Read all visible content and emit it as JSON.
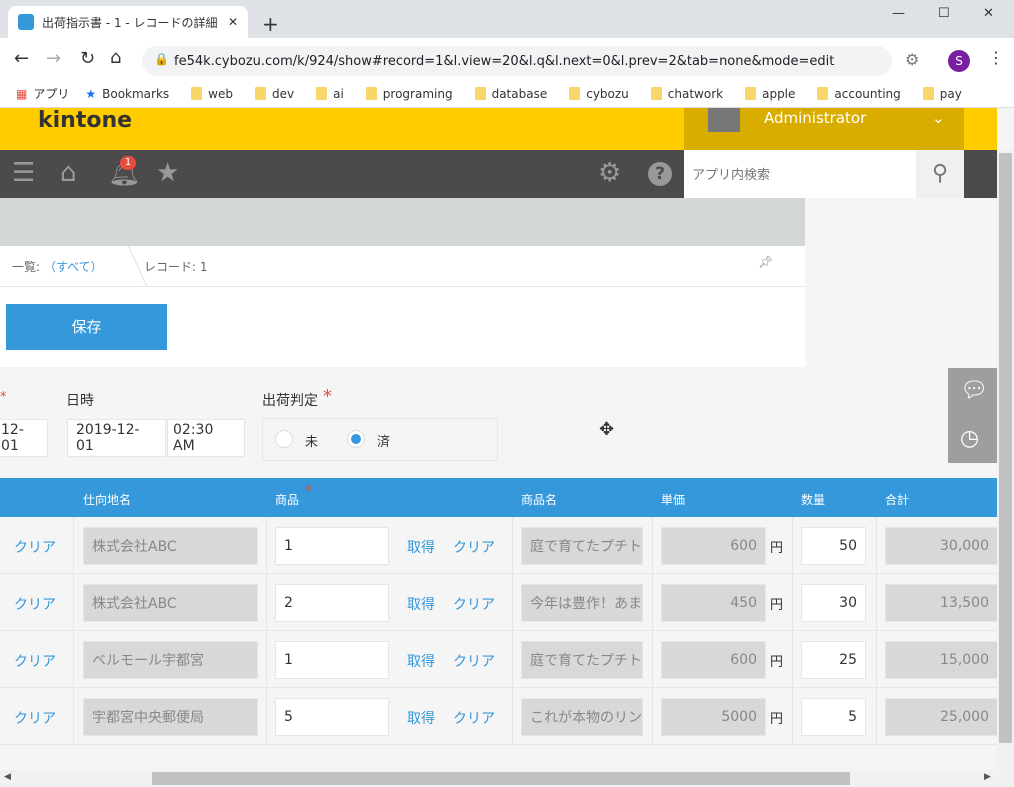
{
  "browser": {
    "tab_title": "出荷指示書 - 1 - レコードの詳細",
    "url": "fe54k.cybozu.com/k/924/show#record=1&l.view=20&l.q&l.next=0&l.prev=2&tab=none&mode=edit",
    "profile_initial": "S",
    "bookmarks": [
      "アプリ",
      "Bookmarks",
      "web",
      "dev",
      "ai",
      "programing",
      "database",
      "cybozu",
      "chatwork",
      "apple",
      "accounting",
      "pay"
    ]
  },
  "header": {
    "logo": "kintone",
    "user": "Administrator",
    "notification_count": "1",
    "search_placeholder": "アプリ内検索"
  },
  "breadcrumb": {
    "list_prefix": "一覧:",
    "list_link": "（すべて）",
    "record": "レコード: 1"
  },
  "save_label": "保存",
  "fields": {
    "required_mark": "*",
    "date_partial": "12-01",
    "datetime_label": "日時",
    "date": "2019-12-01",
    "time": "02:30 AM",
    "judge_label": "出荷判定",
    "options": [
      "未",
      "済"
    ],
    "selected": "済"
  },
  "table": {
    "headers": [
      "仕向地名",
      "商品",
      "商品名",
      "単価",
      "数量",
      "合計"
    ],
    "get_label": "取得",
    "clear_label": "クリア",
    "yen": "円",
    "rows": [
      {
        "dest": "株式会社ABC",
        "product": "1",
        "name": "庭で育てたプチト",
        "price": "600",
        "qty": "50",
        "total": "30,000"
      },
      {
        "dest": "株式会社ABC",
        "product": "2",
        "name": "今年は豊作！あま",
        "price": "450",
        "qty": "30",
        "total": "13,500"
      },
      {
        "dest": "ベルモール宇都宮",
        "product": "1",
        "name": "庭で育てたプチト",
        "price": "600",
        "qty": "25",
        "total": "15,000"
      },
      {
        "dest": "宇都宮中央郵便局",
        "product": "5",
        "name": "これが本物のリン",
        "price": "5000",
        "qty": "5",
        "total": "25,000"
      }
    ]
  },
  "colors": {
    "accent": "#3498db",
    "kintone_yellow": "#ffcc00",
    "nav": "#4b4b4b",
    "required": "#e74c3c"
  }
}
